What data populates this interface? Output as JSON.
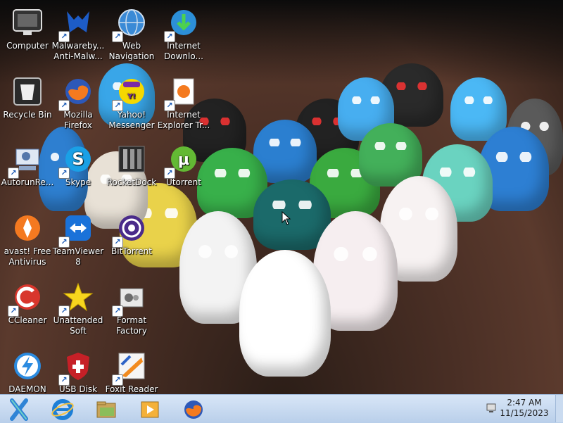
{
  "desktop_icons": [
    {
      "label": "Computer",
      "icon": "computer-icon",
      "shortcut": false
    },
    {
      "label": "Malwareby...\nAnti-Malw...",
      "icon": "malwarebytes-icon",
      "shortcut": true
    },
    {
      "label": "Web\nNavigation",
      "icon": "globe-icon",
      "shortcut": true
    },
    {
      "label": "Internet\nDownlo...",
      "icon": "internet-download-manager-icon",
      "shortcut": true
    },
    {
      "label": "Recycle Bin",
      "icon": "recycle-bin-icon",
      "shortcut": false
    },
    {
      "label": "Mozilla\nFirefox",
      "icon": "firefox-icon",
      "shortcut": true
    },
    {
      "label": "Yahoo!\nMessenger",
      "icon": "yahoo-messenger-icon",
      "shortcut": true
    },
    {
      "label": "Internet\nExplorer Tr...",
      "icon": "internet-explorer-tracking-icon",
      "shortcut": true
    },
    {
      "label": "AutorunRe...",
      "icon": "autorun-icon",
      "shortcut": true
    },
    {
      "label": "Skype",
      "icon": "skype-icon",
      "shortcut": true
    },
    {
      "label": "RocketDock",
      "icon": "rocketdock-icon",
      "shortcut": false
    },
    {
      "label": "Utorrent",
      "icon": "utorrent-icon",
      "shortcut": true
    },
    {
      "label": "avast! Free\nAntivirus",
      "icon": "avast-icon",
      "shortcut": false
    },
    {
      "label": "TeamViewer\n8",
      "icon": "teamviewer-icon",
      "shortcut": true
    },
    {
      "label": "BitTorrent",
      "icon": "bittorrent-icon",
      "shortcut": true
    },
    {
      "label": "CCleaner",
      "icon": "ccleaner-icon",
      "shortcut": true
    },
    {
      "label": "Unattended\nSoft",
      "icon": "star-icon",
      "shortcut": true
    },
    {
      "label": "Format\nFactory",
      "icon": "format-factory-icon",
      "shortcut": true
    },
    {
      "label": "DAEMON",
      "icon": "daemon-tools-icon",
      "shortcut": false
    },
    {
      "label": "USB Disk",
      "icon": "usb-disk-security-icon",
      "shortcut": true
    },
    {
      "label": "Foxit Reader",
      "icon": "foxit-reader-icon",
      "shortcut": true
    }
  ],
  "taskbar": {
    "start_icon": "start-x-icon",
    "pinned": [
      "internet-explorer-icon",
      "file-explorer-icon",
      "media-player-icon",
      "firefox-icon"
    ],
    "tray_icon": "network-icon",
    "time": "2:47 AM",
    "date": "11/15/2023"
  }
}
